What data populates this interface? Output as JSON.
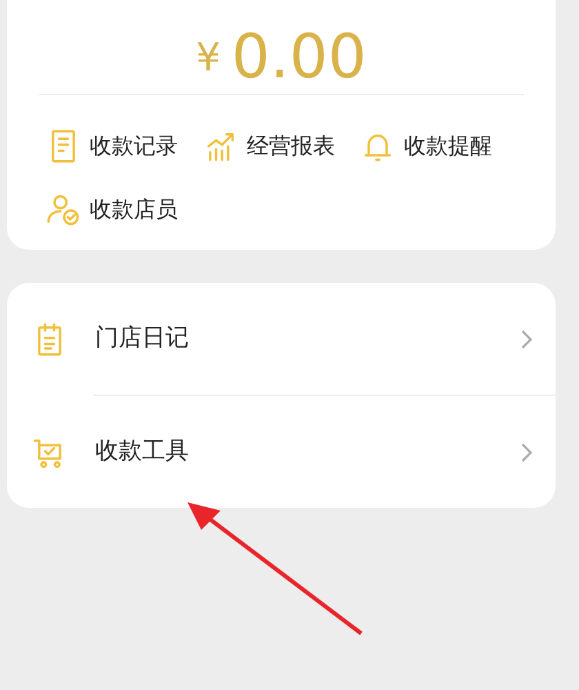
{
  "summary": {
    "amount_symbol": "¥",
    "amount": "0.00"
  },
  "quick_actions": [
    {
      "kind": "record",
      "label": "收款记录"
    },
    {
      "kind": "report",
      "label": "经营报表"
    },
    {
      "kind": "bell",
      "label": "收款提醒"
    },
    {
      "kind": "staff",
      "label": "收款店员"
    }
  ],
  "menu": [
    {
      "kind": "diary",
      "label": "门店日记"
    },
    {
      "kind": "cart",
      "label": "收款工具"
    }
  ]
}
